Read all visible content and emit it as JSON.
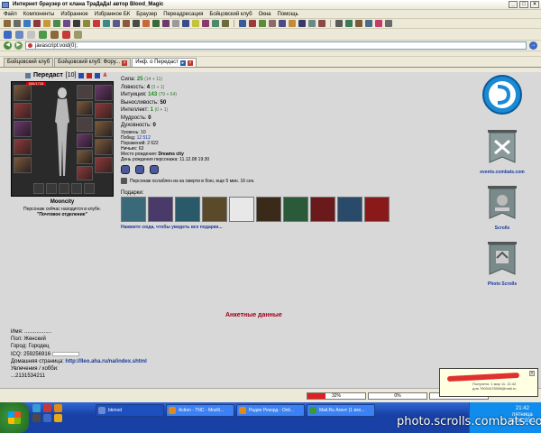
{
  "window": {
    "title": "Интернет браузер от клана ТраДаДа! автор Blood_Magic",
    "buttons": [
      "_",
      "□",
      "×"
    ]
  },
  "menu": [
    "Файл",
    "Компоненты",
    "Избранное",
    "Избранное БК",
    "Браузер",
    "Переадресация",
    "Бойцовский клуб",
    "Окна",
    "Помощь"
  ],
  "address": {
    "value": "javascript:void(0);"
  },
  "tabs": [
    {
      "label": "Бойцовский клуб",
      "active": false
    },
    {
      "label": "Бойцовский клуб: Фору...",
      "active": false
    },
    {
      "label": "Инф. о Передаст",
      "active": true
    }
  ],
  "character": {
    "name": "Передаст",
    "level": "[10]",
    "hp": "555/1728",
    "city": "Mooncity",
    "status_line": "Персонаж сейчас находится в клубе.",
    "location": "\"Почтовое отделение\""
  },
  "stats": [
    {
      "label": "Сила:",
      "value": "25",
      "mod": "(14 + 11)",
      "green": true
    },
    {
      "label": "Ловкость:",
      "value": "4",
      "mod": "(3 + 1)",
      "green": false
    },
    {
      "label": "Интуиция:",
      "value": "143",
      "mod": "(79 + 64)",
      "green": true
    },
    {
      "label": "Выносливость:",
      "value": "50",
      "mod": "",
      "green": false
    },
    {
      "label": "Интеллект:",
      "value": "1",
      "mod": "(0 + 1)",
      "green": true
    },
    {
      "label": "Мудрость:",
      "value": "0",
      "mod": "",
      "green": false
    },
    {
      "label": "Духовность:",
      "value": "0",
      "mod": "",
      "green": false
    }
  ],
  "info": [
    {
      "label": "Уровень:",
      "value": "10"
    },
    {
      "label": "Побед:",
      "value": "12 512"
    },
    {
      "label": "Поражений:",
      "value": "2 622"
    },
    {
      "label": "Ничьих:",
      "value": "63"
    },
    {
      "label": "Место рождения:",
      "value": "Dreams city"
    },
    {
      "label": "День рождения персонажа:",
      "value": "11.12.08 19:30"
    }
  ],
  "weakness": "Персонаж ослаблен из-за смерти в бою, еще 5 мин. 16 сек.",
  "gifts": {
    "label": "Подарки:",
    "link": "Нажмите сюда, чтобы увидеть все подарки...",
    "colors": [
      "#3a6a7a",
      "#4a3a6a",
      "#2a5a6a",
      "#5a4a2a",
      "#e8e8e8",
      "#3a2a1a",
      "#2a5a3a",
      "#6a1a1a",
      "#2a4a6a",
      "#8a1a1a"
    ]
  },
  "sidebar": [
    {
      "label": ""
    },
    {
      "label": "events.combats.com"
    },
    {
      "label": "Scrolls"
    },
    {
      "label": "Photo Scrolls"
    }
  ],
  "anket": {
    "title": "Анкетные данные",
    "name": "Имя: ..................",
    "gender": "Пол: Женский",
    "city": "Город: Городец",
    "icq": "ICQ: 259256916",
    "homepage_label": "Домашняя страница:",
    "homepage": "http://lleo.aha.ru/na/index.shtml",
    "hobby": "Увлечения / хобби:",
    "hobby_value": "...2131534211"
  },
  "statusbar": {
    "progress": [
      {
        "label": "32%",
        "fill": 0.32
      },
      {
        "label": "0%",
        "fill": 0
      },
      {
        "label": "0%",
        "fill": 0
      }
    ]
  },
  "tooltip": {
    "line1": "Получено: 1 мар 11, 21:42",
    "line2": "для 79004478008@mail.ru"
  },
  "taskbar": {
    "items": [
      {
        "label": "bkmod"
      },
      {
        "label": "Action - TNC - Mozill..."
      },
      {
        "label": "Радио Рекорд - Onli..."
      },
      {
        "label": "Mail.Ru Агент (1 вхо..."
      }
    ],
    "clock": "21:42",
    "day": "пятница",
    "date": "11.03.2011"
  },
  "watermark": "photo.scrolls.combats.com"
}
